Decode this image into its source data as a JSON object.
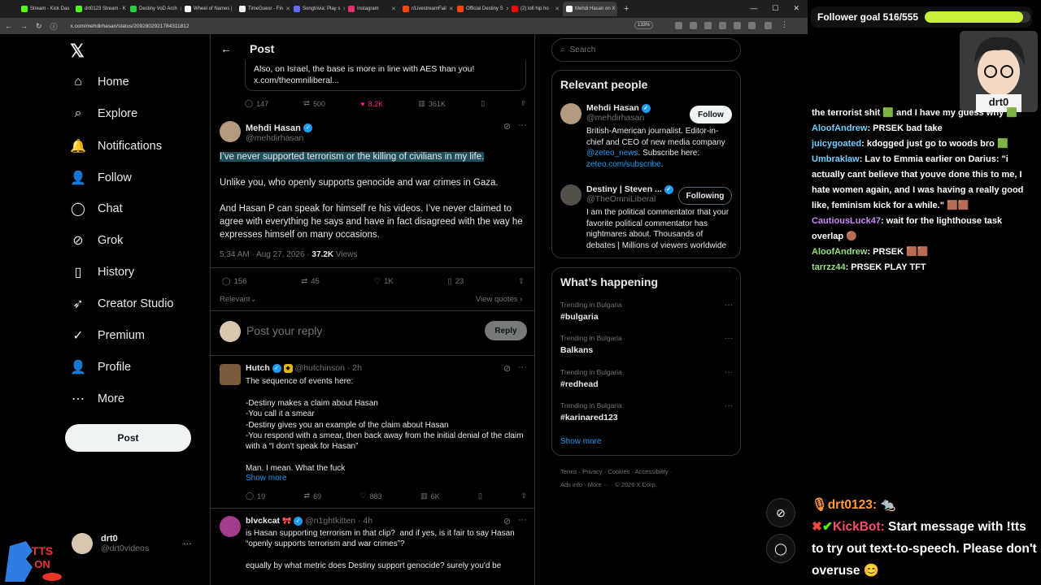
{
  "browser": {
    "tabs": [
      {
        "label": "Stream - Kick Das",
        "color": "#53fc18"
      },
      {
        "label": "drt0123 Stream - K",
        "color": "#53fc18"
      },
      {
        "label": "Destiny VoD Arch",
        "color": "#2ecc40"
      },
      {
        "label": "Wheel of Names |",
        "color": "#ffffff"
      },
      {
        "label": "TimeGuesr - Fin",
        "color": "#eeeeee"
      },
      {
        "label": "Songtrivia: Play s",
        "color": "#5b6bff"
      },
      {
        "label": "Instagram",
        "color": "#e1306c"
      },
      {
        "label": "r/LivestreamFail",
        "color": "#ff4500"
      },
      {
        "label": "Official Destiny S",
        "color": "#ff4500"
      },
      {
        "label": "(2) lofi hip ho",
        "color": "#ff0000"
      },
      {
        "label": "Mehdi Hasan on X",
        "color": "#ffffff",
        "active": true
      }
    ],
    "new_tab": "+",
    "url": "x.com/mehdirhasan/status/2092802921784311812",
    "zoom": "133%"
  },
  "nav": {
    "logo": "𝕏",
    "items": [
      {
        "label": "Home",
        "icon": "⌂"
      },
      {
        "label": "Explore",
        "icon": "⌕"
      },
      {
        "label": "Notifications",
        "icon": "🔔"
      },
      {
        "label": "Follow",
        "icon": "👤"
      },
      {
        "label": "Chat",
        "icon": "◯"
      },
      {
        "label": "Grok",
        "icon": "⊘"
      },
      {
        "label": "History",
        "icon": "▯"
      },
      {
        "label": "Creator Studio",
        "icon": "➶"
      },
      {
        "label": "Premium",
        "icon": "✓"
      },
      {
        "label": "Profile",
        "icon": "👤"
      },
      {
        "label": "More",
        "icon": "⋯"
      }
    ],
    "post_button": "Post",
    "account": {
      "name": "drt0",
      "handle": "@drt0videos",
      "more": "···"
    }
  },
  "main": {
    "header_title": "Post",
    "back_icon": "←",
    "quote_text": "Also, on Israel, the base is more in line with AES than you! x.com/theomniliberal...",
    "quote_actions": {
      "replies": "147",
      "reposts": "500",
      "likes": "8.2K",
      "views": "361K"
    },
    "post": {
      "author": "Mehdi Hasan",
      "handle": "@mehdirhasan",
      "line1": "I’ve never supported terrorism or the killing of civilians in my life.",
      "line2": "Unlike you, who openly supports genocide and war crimes in Gaza.",
      "line3": "And Hasan P can speak for himself re his videos. I’ve never claimed to agree with everything he says and have in fact disagreed with the way he expresses himself on many occasions.",
      "time": "5:34 AM · Aug 27, 2026 · ",
      "views_count": "37.2K",
      "views_label": " Views",
      "replies": "156",
      "reposts": "45",
      "likes": "1K",
      "bookmarks": "23",
      "sort": "Relevant",
      "view_quotes": "View quotes"
    },
    "reply_box": {
      "placeholder": "Post your reply",
      "button": "Reply"
    },
    "replies": [
      {
        "author": "Hutch",
        "handle": "@hutchinson",
        "time": "· 2h",
        "text": "The sequence of events here:\n\n-Destiny makes a claim about Hasan\n-You call it a smear\n-Destiny gives you an example of the claim about Hasan\n-You respond with a smear, then back away from the initial denial of the claim with a “I don’t speak for Hasan”\n\nMan. I mean. What the fuck",
        "show_more": "Show more",
        "replies": "19",
        "reposts": "69",
        "likes": "883",
        "views": "6K"
      },
      {
        "author": "blvckcat",
        "handle": "@n1ghtkitten",
        "time": "· 4h",
        "text": "is Hasan supporting terrorism in that clip?  and if yes, is it fair to say Hasan “openly supports terrorism and war crimes”?\n\nequally by what metric does Destiny support genocide? surely you'd be"
      }
    ]
  },
  "sidebar": {
    "search_placeholder": "Search",
    "relevant_title": "Relevant people",
    "people": [
      {
        "name": "Mehdi Hasan",
        "handle": "@mehdirhasan",
        "bio_a": "British-American journalist. Editor-in-chief and CEO of new media company ",
        "bio_link1": "@zeteo_news",
        "bio_b": ". Subscribe here: ",
        "bio_link2": "zeteo.com/subscribe",
        "bio_c": ".",
        "button": "Follow"
      },
      {
        "name": "Destiny | Steven ...",
        "handle": "@TheOmniLiberal",
        "bio": "I am the political commentator that your favorite political commentator has nightmares about. Thousands of debates | Millions of viewers worldwide",
        "button": "Following"
      }
    ],
    "happening_title": "What’s happening",
    "trends": [
      {
        "category": "Trending in Bulgaria",
        "title": "#bulgaria"
      },
      {
        "category": "Trending in Bulgaria",
        "title": "Balkans"
      },
      {
        "category": "Trending in Bulgaria",
        "title": "#redhead"
      },
      {
        "category": "Trending in Bulgaria",
        "title": "#karinared123"
      }
    ],
    "show_more": "Show more",
    "footer_line1": "Terms  ·  Privacy  ·  Cookies  ·  Accessibility  ·",
    "footer_line2": "Ads info  ·  More ···  ·  © 2026 X Corp."
  },
  "stream": {
    "goal_label": "Follower goal 516/555",
    "goal_progress": 0.93,
    "cam_name": "drt0",
    "chat": [
      {
        "user": "",
        "msg": "the terrorist shit 🟩 and I have my guess why 🟩"
      },
      {
        "user": "AloofAndrew",
        "msg": ": PRSEK bad take"
      },
      {
        "user": "juicygoated",
        "msg": ": kdogged just go to woods bro 🟩"
      },
      {
        "user": "Umbraklaw",
        "msg": ": Lav to Emmia earlier on Darius: \"i actually cant believe that youve done this to me, I hate women again, and I was having a really good like, feminism kick for a while.\" 🟫🟫"
      },
      {
        "user": "CautiousLuck47",
        "msg": ": wait for the lighthouse task overlap 🟤"
      },
      {
        "user": "AloofAndrew",
        "msg": ": PRSEK 🟫🟫"
      },
      {
        "user": "tarrzz44",
        "msg": ": PRSEK PLAY TFT"
      }
    ],
    "tts_user": "drt0123:",
    "tts_bot": "KickBot:",
    "tts_msg": " Start message with !tts to try out text-to-speech. Please don't overuse 😊",
    "tts_logo_top": "TTS",
    "tts_logo_bottom": "ON"
  }
}
